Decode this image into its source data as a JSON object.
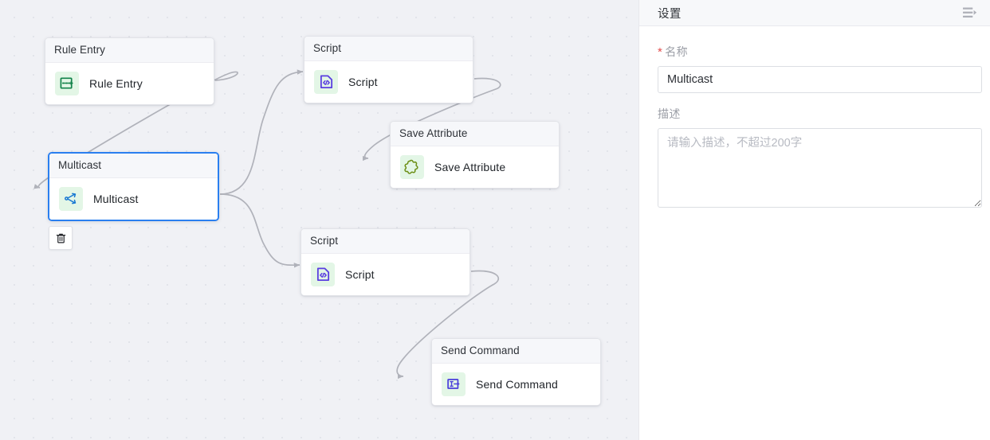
{
  "canvas": {
    "background_color": "#f0f1f5",
    "grid": "dot-grid",
    "nodes": [
      {
        "id": "rule-entry",
        "header": "Rule Entry",
        "label": "Rule Entry",
        "icon": "rule-entry-icon",
        "icon_color": "#12824a",
        "icon_bg": "#e3f6e6",
        "selected": false
      },
      {
        "id": "script-1",
        "header": "Script",
        "label": "Script",
        "icon": "script-code-icon",
        "icon_color": "#5a3ee0",
        "icon_bg": "#e3f6e6",
        "selected": false
      },
      {
        "id": "multicast",
        "header": "Multicast",
        "label": "Multicast",
        "icon": "multicast-share-icon",
        "icon_color": "#1878d2",
        "icon_bg": "#e3f6e6",
        "selected": true,
        "selected_border_color": "#2a7ff0"
      },
      {
        "id": "save-attribute",
        "header": "Save Attribute",
        "label": "Save Attribute",
        "icon": "puzzle-piece-icon",
        "icon_color": "#6b8e14",
        "icon_bg": "#e3f6e6",
        "selected": false
      },
      {
        "id": "script-2",
        "header": "Script",
        "label": "Script",
        "icon": "script-code-icon",
        "icon_color": "#5a3ee0",
        "icon_bg": "#e3f6e6",
        "selected": false
      },
      {
        "id": "send-command",
        "header": "Send Command",
        "label": "Send Command",
        "icon": "send-command-icon",
        "icon_color": "#4a3edb",
        "icon_bg": "#e3f6e6",
        "selected": false
      }
    ],
    "edges": [
      {
        "from": "rule-entry",
        "to": "multicast"
      },
      {
        "from": "multicast",
        "to": "script-1"
      },
      {
        "from": "multicast",
        "to": "script-2"
      },
      {
        "from": "script-1",
        "to": "save-attribute"
      },
      {
        "from": "script-2",
        "to": "send-command"
      }
    ],
    "edge_color": "#b0b2ba",
    "delete_button": {
      "icon": "trash-icon",
      "tooltip": ""
    }
  },
  "panel": {
    "title": "设置",
    "collapse_icon": "panel-collapse-icon",
    "fields": {
      "name": {
        "label": "名称",
        "required_marker": "*",
        "value": "Multicast"
      },
      "description": {
        "label": "描述",
        "value": "",
        "placeholder": "请输入描述，不超过200字"
      }
    }
  }
}
